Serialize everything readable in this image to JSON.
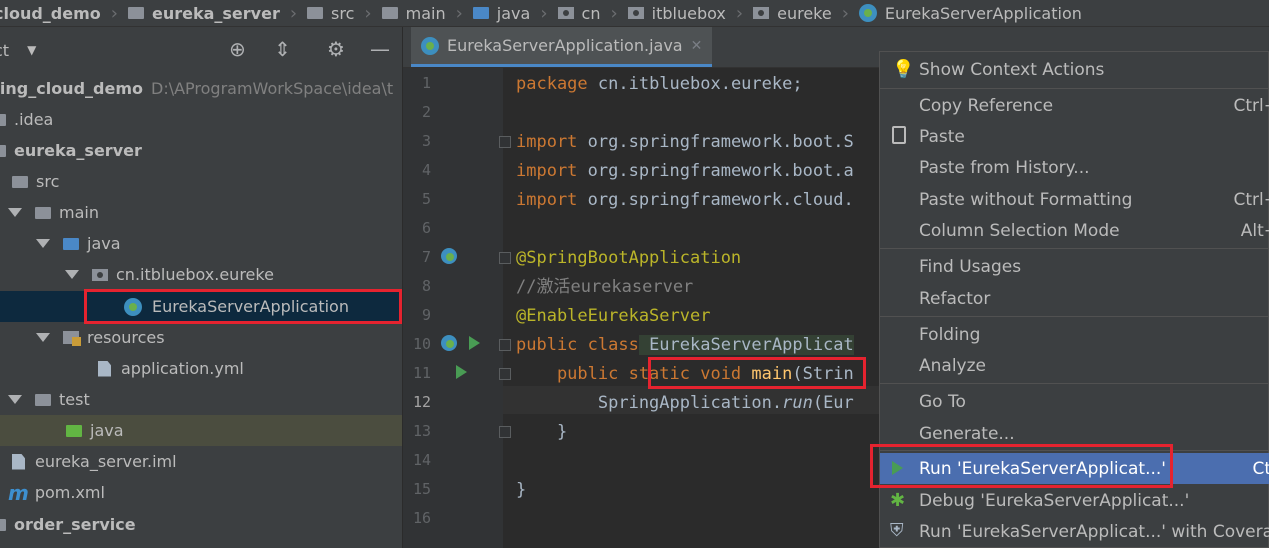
{
  "breadcrumb": [
    {
      "label": "cloud_demo",
      "icon": "module-folder-icon"
    },
    {
      "label": "eureka_server",
      "icon": "module-folder-icon"
    },
    {
      "label": "src",
      "icon": "folder-icon"
    },
    {
      "label": "main",
      "icon": "folder-icon"
    },
    {
      "label": "java",
      "icon": "source-folder-icon"
    },
    {
      "label": "cn",
      "icon": "package-icon"
    },
    {
      "label": "itbluebox",
      "icon": "package-icon"
    },
    {
      "label": "eureke",
      "icon": "package-icon"
    },
    {
      "label": "EurekaServerApplication",
      "icon": "spring-boot-class-icon"
    }
  ],
  "project": {
    "title": "ct",
    "tree": [
      {
        "label": "ring_cloud_demo",
        "path": "D:\\AProgramWorkSpace\\idea\\t"
      },
      {
        "label": ".idea"
      },
      {
        "label": "eureka_server"
      },
      {
        "label": "src"
      },
      {
        "label": "main"
      },
      {
        "label": "java"
      },
      {
        "label": "cn.itbluebox.eureke"
      },
      {
        "label": "EurekaServerApplication"
      },
      {
        "label": "resources"
      },
      {
        "label": "application.yml"
      },
      {
        "label": "test"
      },
      {
        "label": "java"
      },
      {
        "label": "eureka_server.iml"
      },
      {
        "label": "pom.xml"
      },
      {
        "label": "order_service"
      }
    ]
  },
  "editor": {
    "tab_label": "EurekaServerApplication.java",
    "line_numbers": [
      "1",
      "2",
      "3",
      "4",
      "5",
      "6",
      "7",
      "8",
      "9",
      "10",
      "11",
      "12",
      "13",
      "14",
      "15",
      "16"
    ],
    "code": {
      "l1_kw": "package",
      "l1_rest": " cn.itbluebox.eureke;",
      "l3_kw": "import",
      "l3_rest": " org.springframework.boot.S",
      "l4_kw": "import",
      "l4_rest": " org.springframework.boot.a",
      "l5_kw": "import",
      "l5_rest": " org.springframework.cloud.",
      "l7": "@SpringBootApplication",
      "l8": "//激活eurekaserver",
      "l9": "@EnableEurekaServer",
      "l10_kw": "public class",
      "l10_cls": " EurekaServerApplicat",
      "l11_kw": "    public static void",
      "l11_fn": " main",
      "l11_rest": "(Strin",
      "l12_a": "        SpringApplication.",
      "l12_b": "run",
      "l12_c": "(Eur",
      "l13": "    }",
      "l15": "}"
    }
  },
  "context_menu": {
    "items": [
      {
        "label": "Show Context Actions",
        "shortcut": "",
        "icon": "bulb-icon"
      },
      {
        "label": "Copy Reference",
        "shortcut": "Ctrl+",
        "icon": ""
      },
      {
        "label": "Paste",
        "shortcut": "",
        "icon": "clipboard-icon"
      },
      {
        "label": "Paste from History...",
        "shortcut": "",
        "icon": ""
      },
      {
        "label": "Paste without Formatting",
        "shortcut": "Ctrl+",
        "icon": ""
      },
      {
        "label": "Column Selection Mode",
        "shortcut": "Alt+",
        "icon": ""
      },
      {
        "label": "Find Usages",
        "shortcut": "",
        "icon": ""
      },
      {
        "label": "Refactor",
        "shortcut": "",
        "icon": ""
      },
      {
        "label": "Folding",
        "shortcut": "",
        "icon": ""
      },
      {
        "label": "Analyze",
        "shortcut": "",
        "icon": ""
      },
      {
        "label": "Go To",
        "shortcut": "",
        "icon": ""
      },
      {
        "label": "Generate...",
        "shortcut": "",
        "icon": ""
      },
      {
        "label": "Run 'EurekaServerApplicat...'",
        "shortcut": "Ctr",
        "icon": "run-icon"
      },
      {
        "label": "Debug 'EurekaServerApplicat...'",
        "shortcut": "",
        "icon": "debug-icon"
      },
      {
        "label": "Run 'EurekaServerApplicat...' with Coverage",
        "shortcut": "",
        "icon": "coverage-icon"
      }
    ]
  },
  "colors": {
    "highlight_box": "#e5232f",
    "menu_selection": "#4b6eaf",
    "tree_selection": "#0d293e"
  }
}
